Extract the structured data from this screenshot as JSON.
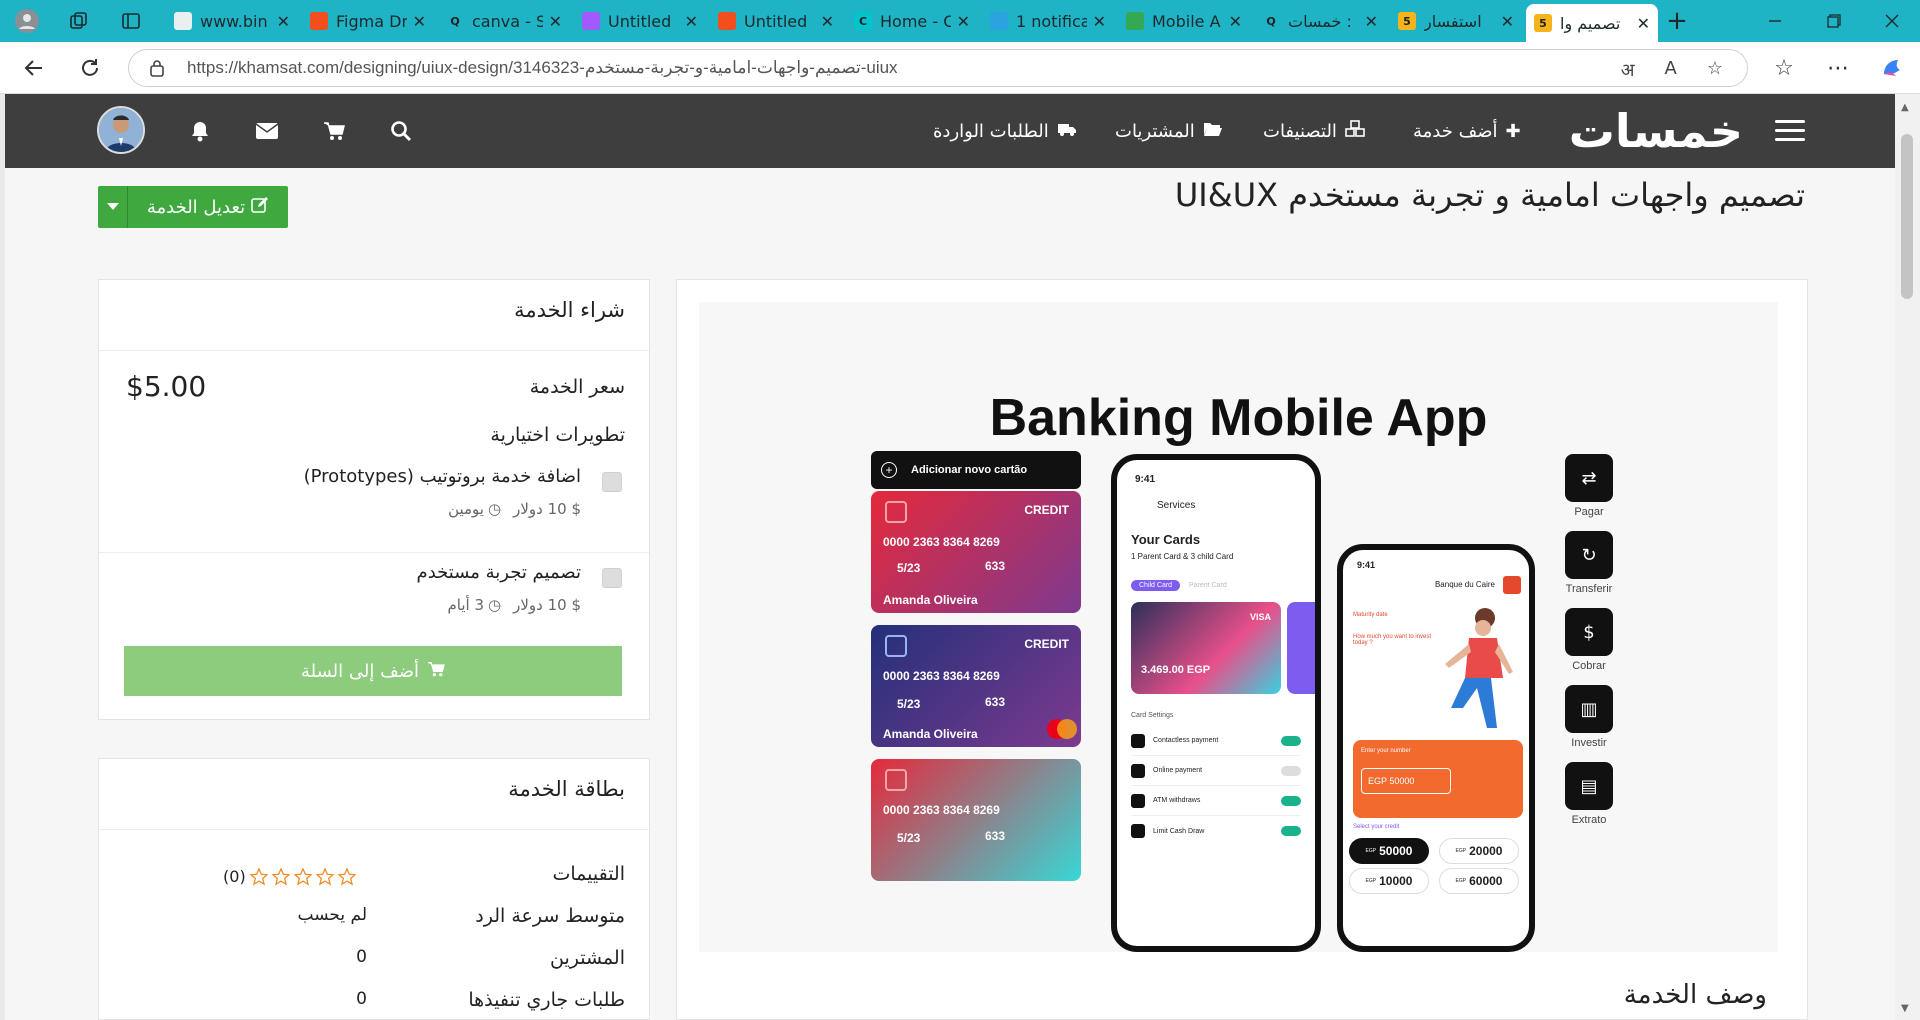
{
  "tabs": [
    {
      "title": "www.bin",
      "fav_color": "#e8f0f0",
      "fav_text": "",
      "active": false
    },
    {
      "title": "Figma Dr",
      "fav_color": "#f24e1e",
      "fav_text": "",
      "active": false
    },
    {
      "title": "canva - S",
      "fav_color": "#1fb3c6",
      "fav_text": "Q",
      "active": false
    },
    {
      "title": "Untitled",
      "fav_color": "#a259ff",
      "fav_text": "",
      "active": false
    },
    {
      "title": "Untitled",
      "fav_color": "#f24e1e",
      "fav_text": "",
      "active": false
    },
    {
      "title": "Home - C",
      "fav_color": "#00c4cc",
      "fav_text": "C",
      "active": false
    },
    {
      "title": "1 notifica",
      "fav_color": "#2aa3df",
      "fav_text": "",
      "active": false
    },
    {
      "title": "Mobile A",
      "fav_color": "#34a853",
      "fav_text": "",
      "active": false
    },
    {
      "title": "خمسات :",
      "fav_color": "#1fb3c6",
      "fav_text": "Q",
      "active": false
    },
    {
      "title": "استفسار",
      "fav_color": "#f4b41a",
      "fav_text": "5",
      "active": false
    },
    {
      "title": "تصميم وا",
      "fav_color": "#f4b41a",
      "fav_text": "5",
      "active": true
    }
  ],
  "address": {
    "url": "https://khamsat.com/designing/uiux-design/3146323-تصميم-واجهات-امامية-و-تجربة-مستخدم-uiux"
  },
  "site": {
    "logo_text": "خمسات",
    "menu": [
      "أضف خدمة",
      "التصنيفات",
      "المشتريات",
      "الطلبات الواردة"
    ],
    "icons": [
      "search-icon",
      "cart-icon",
      "envelope-icon",
      "bell-icon"
    ]
  },
  "service": {
    "title": "تصميم واجهات امامية و تجربة مستخدم UI&UX",
    "edit_label": "تعديل الخدمة",
    "hero_title": "Banking Mobile App",
    "description_title": "وصف الخدمة"
  },
  "buy": {
    "title": "شراء الخدمة",
    "price_label": "سعر الخدمة",
    "price_value": "$5.00",
    "extras_title": "تطويرات اختيارية",
    "extras": [
      {
        "label": "اضافة خدمة بروتوتيب (Prototypes)",
        "price": "10 دولار",
        "price_sym": "$",
        "duration": "يومين"
      },
      {
        "label": "تصميم تجربة مستخدم",
        "price": "10 دولار",
        "price_sym": "$",
        "duration": "3 أيام"
      }
    ],
    "cart_label": "أضف إلى السلة"
  },
  "card": {
    "title": "بطاقة الخدمة",
    "rows": [
      {
        "label": "التقييمات",
        "value": "(0)"
      },
      {
        "label": "متوسط سرعة الرد",
        "value": "لم يحسب"
      },
      {
        "label": "المشترين",
        "value": "0"
      },
      {
        "label": "طلبات جاري تنفيذها",
        "value": "0"
      }
    ]
  },
  "mock": {
    "add_card": "Adicionar novo cartão",
    "cards": [
      {
        "type": "CREDIT",
        "number": "0000 2363 8364 8269",
        "exp": "5/23",
        "cvv": "633",
        "name": "Amanda Oliveira",
        "color": "linear-gradient(135deg,#e5293b,#7d3a8f)"
      },
      {
        "type": "CREDIT",
        "number": "0000 2363 8364 8269",
        "exp": "5/23",
        "cvv": "633",
        "name": "Amanda Oliveira",
        "color": "linear-gradient(135deg,#24307a,#7d3a8f)"
      },
      {
        "type": "",
        "number": "0000 2363 8364 8269",
        "exp": "5/23",
        "cvv": "633",
        "name": "",
        "color": "linear-gradient(135deg,#e5293b,#38d7d7)"
      }
    ],
    "phone1": {
      "time": "9:41",
      "header": "Services",
      "title": "Your Cards",
      "subtitle": "1 Parent Card & 3 child Card",
      "tab1": "Child Card",
      "tab2": "Parent Card",
      "balance": "3.469.00 EGP",
      "card_brand": "VISA",
      "settings_title": "Card Settings",
      "settings": [
        "Contactless payment",
        "Online payment",
        "ATM withdraws",
        "Limit Cash Draw"
      ]
    },
    "phone2": {
      "time": "9:41",
      "bank": "Banque du Caire",
      "maturity": "Maturity date",
      "question": "How much you want to invest today ?",
      "enter": "Enter your number",
      "amount": "EGP 50000",
      "select": "Select your credit",
      "options": [
        "50000",
        "20000",
        "10000",
        "60000"
      ],
      "currency": "EGP"
    },
    "actions": [
      "Pagar",
      "Transferir",
      "Cobrar",
      "Investir",
      "Extrato"
    ]
  }
}
